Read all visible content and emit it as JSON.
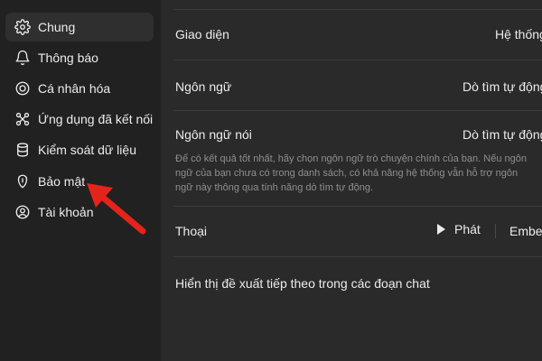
{
  "sidebar": {
    "items": [
      {
        "label": "Chung",
        "icon": "gear-icon",
        "active": true
      },
      {
        "label": "Thông báo",
        "icon": "bell-icon"
      },
      {
        "label": "Cá nhân hóa",
        "icon": "personalize-icon"
      },
      {
        "label": "Ứng dụng đã kết nối",
        "icon": "connected-apps-icon"
      },
      {
        "label": "Kiểm soát dữ liệu",
        "icon": "database-icon"
      },
      {
        "label": "Bảo mật",
        "icon": "security-icon"
      },
      {
        "label": "Tài khoản",
        "icon": "account-icon"
      }
    ]
  },
  "settings": {
    "theme": {
      "label": "Giao diện",
      "value": "Hệ thống"
    },
    "language": {
      "label": "Ngôn ngữ",
      "value": "Dò tìm tự động"
    },
    "spoken_language": {
      "label": "Ngôn ngữ nói",
      "value": "Dò tìm tự động",
      "helper": "Để có kết quả tốt nhất, hãy chọn ngôn ngữ trò chuyện chính của bạn. Nếu ngôn ngữ của bạn chưa có trong danh sách, có khả năng hệ thống vẫn hỗ trợ ngôn ngữ này thông qua tính năng dò tìm tự động."
    },
    "voice": {
      "label": "Thoại",
      "play_label": "Phát",
      "voice_name": "Ember"
    },
    "follow_up": {
      "label": "Hiển thị đề xuất tiếp theo trong các đoạn chat"
    }
  },
  "colors": {
    "sidebar_bg": "#212121",
    "content_bg": "#2a2a2a",
    "active_item_bg": "#2f2f2f",
    "annotation_arrow": "#e3241b"
  }
}
